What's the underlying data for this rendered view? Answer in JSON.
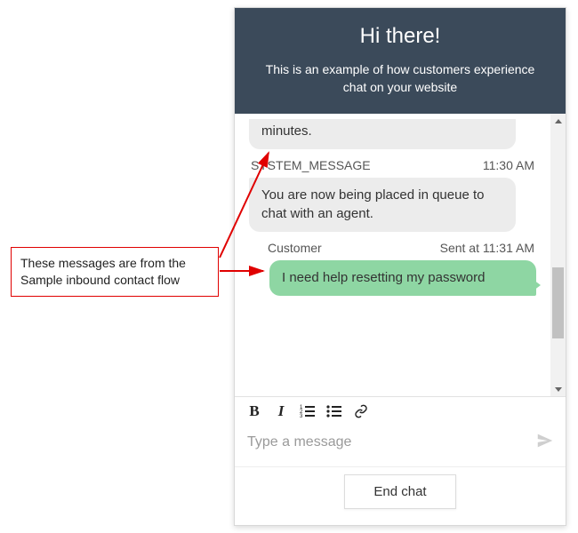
{
  "callout": {
    "text": "These messages are from the Sample inbound contact flow"
  },
  "header": {
    "title": "Hi there!",
    "subtitle": "This is an example of how customers experience chat on your website"
  },
  "messages": {
    "partial_bubble": "minutes.",
    "system": {
      "sender": "SYSTEM_MESSAGE",
      "time": "11:30 AM",
      "text": "You are now being placed in queue to chat with an agent."
    },
    "customer": {
      "sender": "Customer",
      "time_prefix": "Sent at",
      "time": "11:31 AM",
      "text": "I need help resetting my password"
    }
  },
  "composer": {
    "placeholder": "Type a message"
  },
  "footer": {
    "end_chat": "End chat"
  }
}
